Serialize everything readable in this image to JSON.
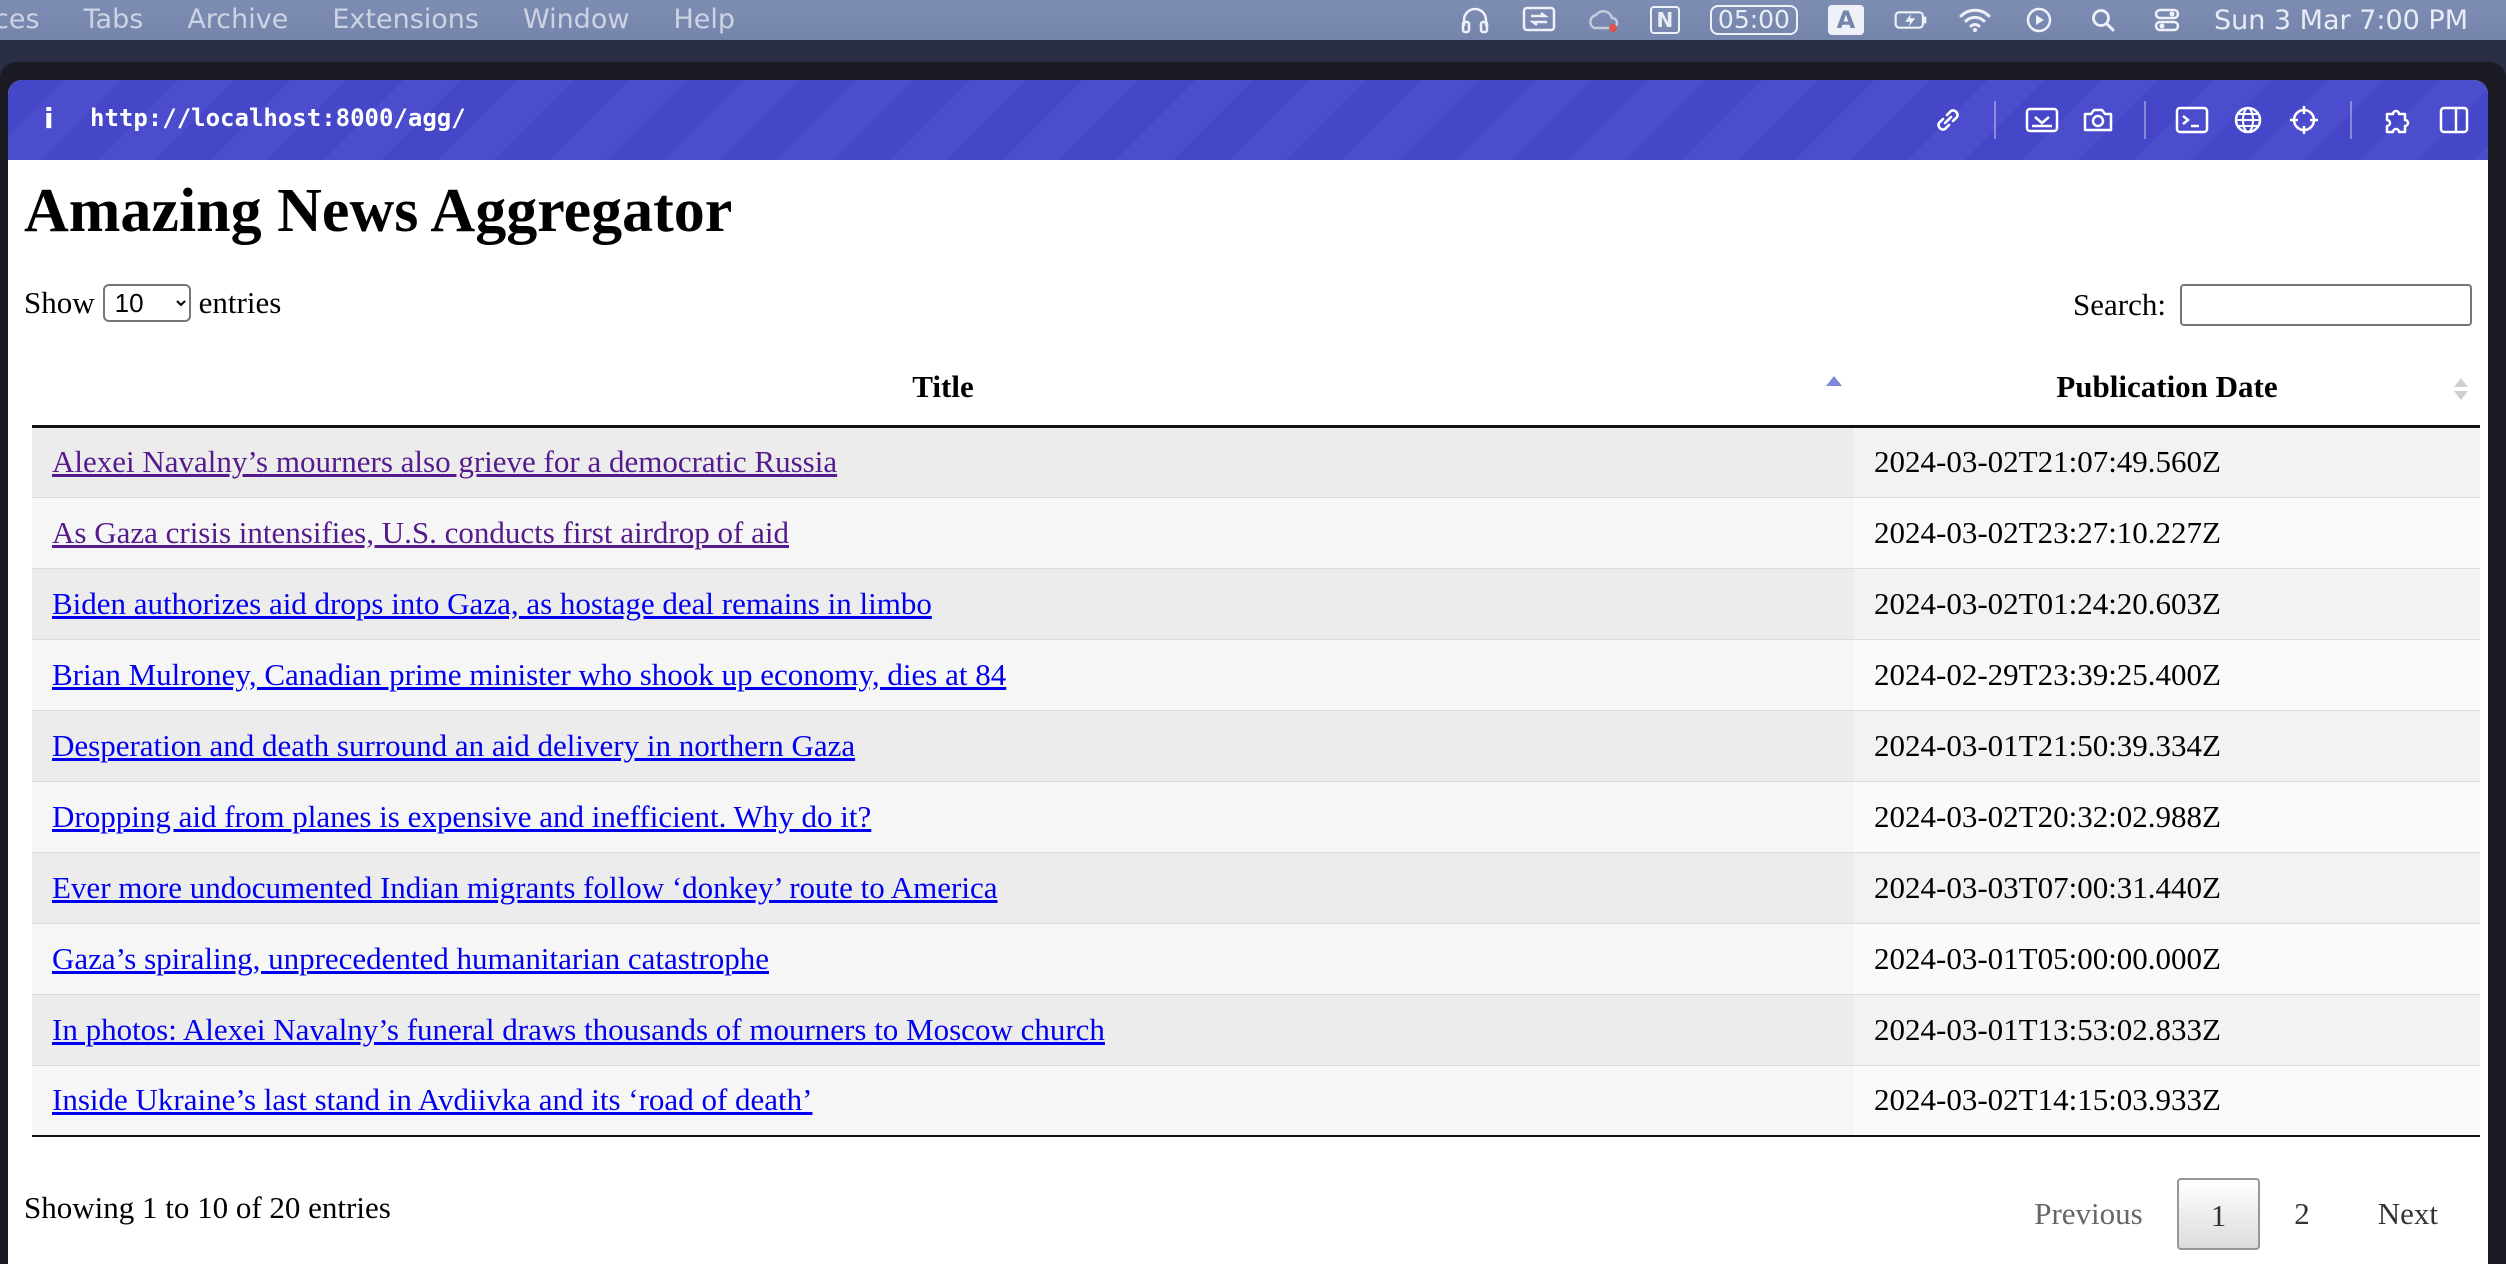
{
  "menubar": {
    "menus": [
      "ces",
      "Tabs",
      "Archive",
      "Extensions",
      "Window",
      "Help"
    ],
    "timer": "05:00",
    "ime": "A",
    "notion": "N",
    "datetime": "Sun 3 Mar  7:00 PM"
  },
  "browser": {
    "info_icon": "i",
    "url": "http://localhost:8000/agg/"
  },
  "page": {
    "title": "Amazing News Aggregator",
    "length": {
      "prefix": "Show",
      "value": "10",
      "options": [
        "10"
      ],
      "suffix": "entries"
    },
    "search": {
      "label": "Search:",
      "value": ""
    },
    "columns": [
      "Title",
      "Publication Date"
    ],
    "rows": [
      {
        "title": "Alexei Navalny’s mourners also grieve for a democratic Russia",
        "date": "2024-03-02T21:07:49.560Z",
        "visited": true
      },
      {
        "title": "As Gaza crisis intensifies, U.S. conducts first airdrop of aid",
        "date": "2024-03-02T23:27:10.227Z",
        "visited": true
      },
      {
        "title": "Biden authorizes aid drops into Gaza, as hostage deal remains in limbo",
        "date": "2024-03-02T01:24:20.603Z",
        "visited": false
      },
      {
        "title": "Brian Mulroney, Canadian prime minister who shook up economy, dies at 84",
        "date": "2024-02-29T23:39:25.400Z",
        "visited": false
      },
      {
        "title": "Desperation and death surround an aid delivery in northern Gaza",
        "date": "2024-03-01T21:50:39.334Z",
        "visited": false
      },
      {
        "title": "Dropping aid from planes is expensive and inefficient. Why do it?",
        "date": "2024-03-02T20:32:02.988Z",
        "visited": false
      },
      {
        "title": "Ever more undocumented Indian migrants follow ‘donkey’ route to America",
        "date": "2024-03-03T07:00:31.440Z",
        "visited": false
      },
      {
        "title": "Gaza’s spiraling, unprecedented humanitarian catastrophe",
        "date": "2024-03-01T05:00:00.000Z",
        "visited": false
      },
      {
        "title": "In photos: Alexei Navalny’s funeral draws thousands of mourners to Moscow church",
        "date": "2024-03-01T13:53:02.833Z",
        "visited": false
      },
      {
        "title": "Inside Ukraine’s last stand in Avdiivka and its ‘road of death’",
        "date": "2024-03-02T14:15:03.933Z",
        "visited": false
      }
    ],
    "info": "Showing 1 to 10 of 20 entries",
    "pagination": {
      "previous": "Previous",
      "pages": [
        "1",
        "2"
      ],
      "current": "1",
      "next": "Next"
    }
  },
  "colors": {
    "toolbar": "#4546c8",
    "link": "#0000ee",
    "visited_link": "#551a8b",
    "sort_active": "#7b8ad6"
  }
}
